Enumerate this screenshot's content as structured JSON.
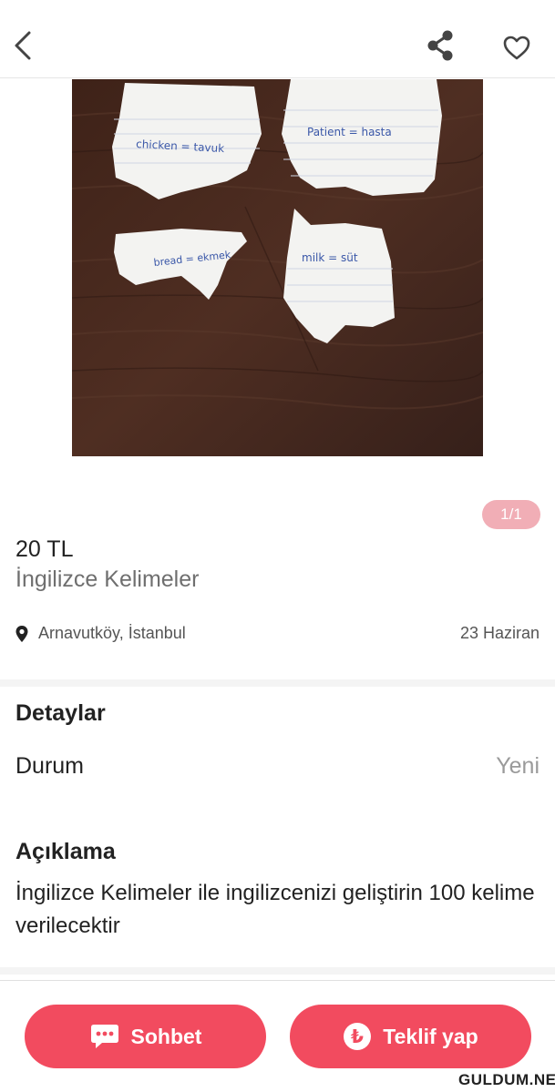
{
  "header": {
    "back_icon": "chevron-left-icon",
    "share_icon": "share-icon",
    "favorite_icon": "heart-outline-icon"
  },
  "gallery": {
    "counter": "1/1",
    "photo_notes": [
      "chicken = tavuk",
      "Patient = hasta",
      "bread = ekmek",
      "milk = süt"
    ]
  },
  "listing": {
    "price": "20 TL",
    "title": "İngilizce Kelimeler",
    "location": "Arnavutköy, İstanbul",
    "date": "23 Haziran"
  },
  "details": {
    "heading": "Detaylar",
    "condition_label": "Durum",
    "condition_value": "Yeni"
  },
  "description": {
    "heading": "Açıklama",
    "text": "İngilizce Kelimeler ile ingilizcenizi geliştirin 100 kelime verilecektir"
  },
  "actions": {
    "chat_label": "Sohbet",
    "offer_label": "Teklif yap"
  },
  "watermark": "GULDUM.NET",
  "colors": {
    "accent": "#f24b5f",
    "counter_bg": "#f1aeb6",
    "wood": "#4a2a1f"
  }
}
